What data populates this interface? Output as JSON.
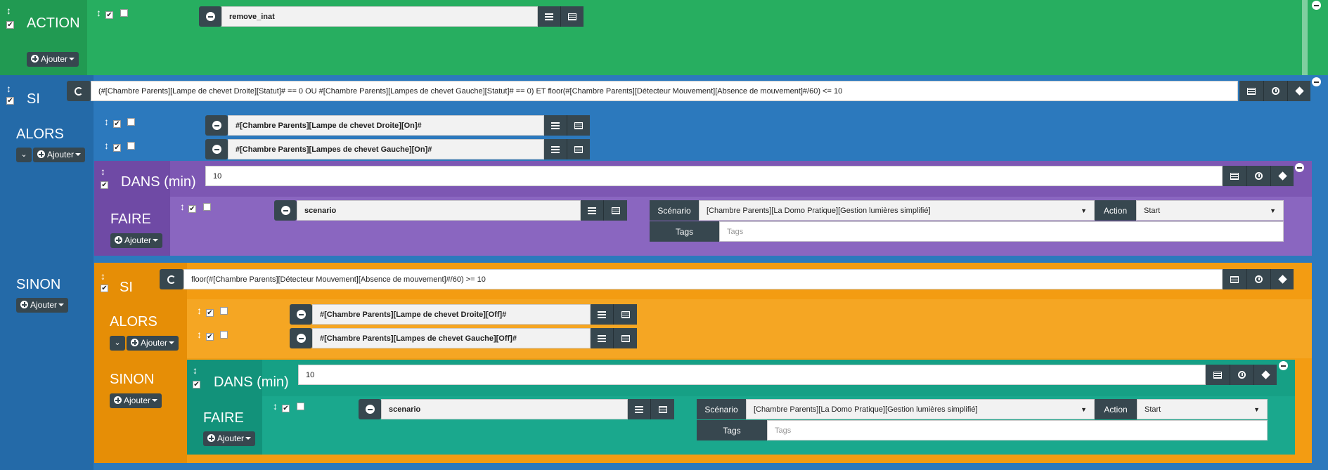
{
  "colors": {
    "green": "#27ae60",
    "blue": "#2c79bd",
    "purple": "#7d57b3",
    "orange": "#f39c12",
    "teal": "#16a085",
    "dark": "#37474f"
  },
  "action_block": {
    "title": "ACTION",
    "add_label": "Ajouter",
    "command_value": "remove_inat"
  },
  "if_block": {
    "title": "SI",
    "condition": "(#[Chambre Parents][Lampe de chevet Droite][Statut]# == 0 OU #[Chambre Parents][Lampes de chevet Gauche][Statut]# == 0) ET floor(#[Chambre Parents][Détecteur Mouvement][Absence de mouvement]#/60) <= 10",
    "then_title": "ALORS",
    "then_add": "Ajouter",
    "then_actions": [
      "#[Chambre Parents][Lampe de chevet Droite][On]#",
      "#[Chambre Parents][Lampes de chevet Gauche][On]#"
    ],
    "in_block": {
      "title": "DANS (min)",
      "value": "10",
      "do_title": "FAIRE",
      "do_add": "Ajouter",
      "command": "scenario",
      "scenario_label": "Scénario",
      "scenario_value": "[Chambre Parents][La Domo Pratique][Gestion lumières simplifié]",
      "action_label": "Action",
      "action_value": "Start",
      "tags_label": "Tags",
      "tags_placeholder": "Tags"
    },
    "else_title": "SINON",
    "else_add": "Ajouter"
  },
  "nested_if": {
    "title": "SI",
    "condition": "floor(#[Chambre Parents][Détecteur Mouvement][Absence de mouvement]#/60)  >= 10",
    "then_title": "ALORS",
    "then_add": "Ajouter",
    "then_actions": [
      "#[Chambre Parents][Lampe de chevet Droite][Off]#",
      "#[Chambre Parents][Lampes de chevet Gauche][Off]#"
    ],
    "else_title": "SINON",
    "else_add": "Ajouter",
    "in_block": {
      "title": "DANS (min)",
      "value": "10",
      "do_title": "FAIRE",
      "do_add": "Ajouter",
      "command": "scenario",
      "scenario_label": "Scénario",
      "scenario_value": "[Chambre Parents][La Domo Pratique][Gestion lumières simplifié]",
      "action_label": "Action",
      "action_value": "Start",
      "tags_label": "Tags",
      "tags_placeholder": "Tags"
    }
  }
}
